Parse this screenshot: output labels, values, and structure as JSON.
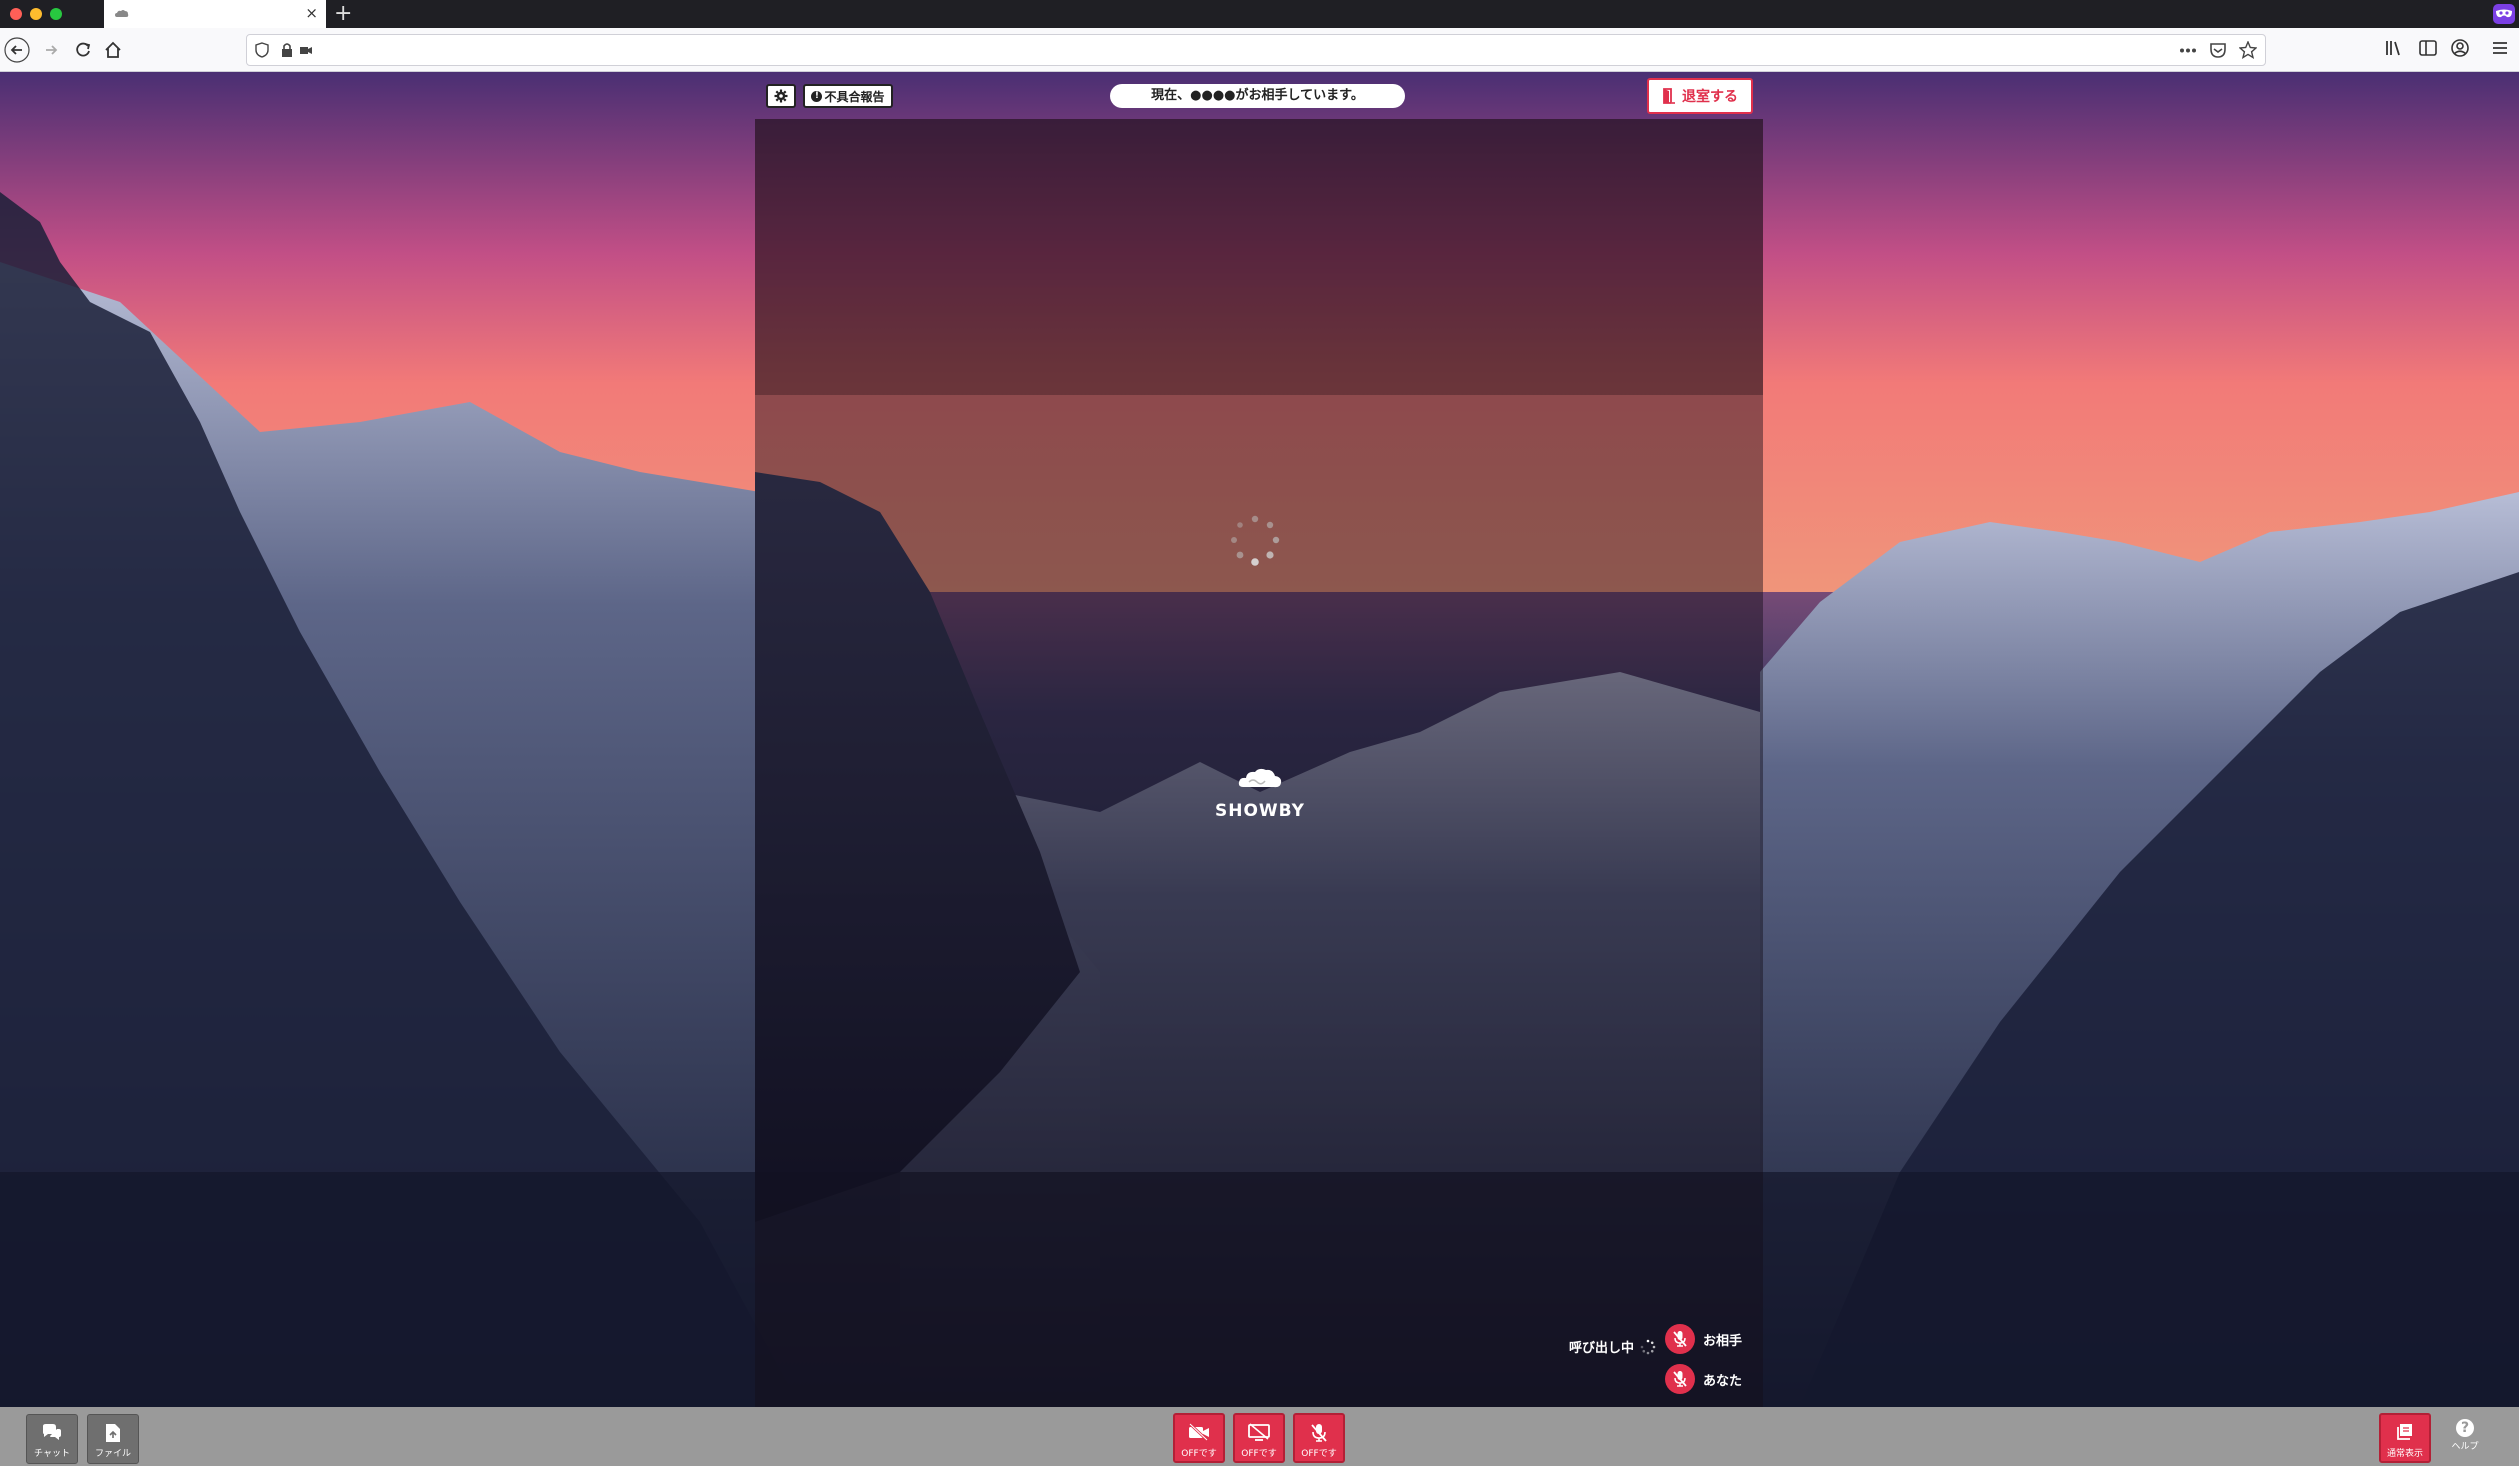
{
  "browser": {
    "tab_close": "×",
    "new_tab": "+",
    "url": ""
  },
  "header": {
    "report_label": "不具合報告",
    "status_text": "現在、●●●●がお相手しています。",
    "leave_label": "退室する"
  },
  "video": {
    "brand_name": "SHOWBY",
    "call_status": "呼び出し中",
    "partner_label": "お相手",
    "you_label": "あなた"
  },
  "toolbar": {
    "chat_label": "チャット",
    "file_label": "ファイル",
    "video_off_label": "OFFです",
    "screen_off_label": "OFFです",
    "mic_off_label": "OFFです",
    "view_label": "通常表示",
    "help_label": "ヘルプ"
  },
  "colors": {
    "accent_red": "#e0304c",
    "toolbar_gray": "#9a9a9a"
  }
}
